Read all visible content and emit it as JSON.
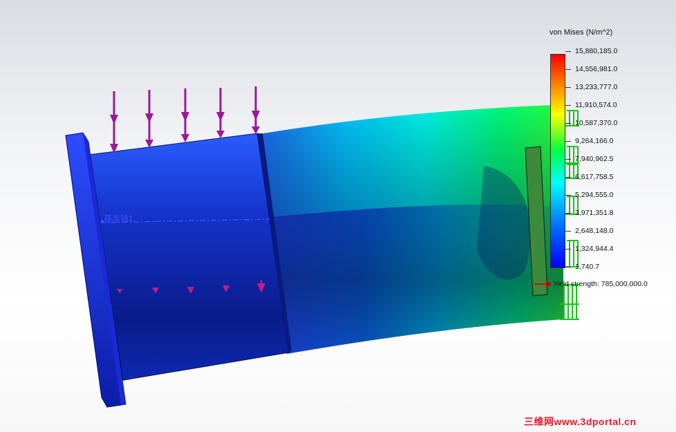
{
  "plot": {
    "legend_title": "von Mises (N/m^2)",
    "ticks": [
      "15,880,185.0",
      "14,556,981.0",
      "13,233,777.0",
      "11,910,574.0",
      "10,587,370.0",
      "9,264,166.0",
      "7,940,962.5",
      "6,617,758.5",
      "5,294,555.0",
      "3,971,351.8",
      "2,648,148.0",
      "1,324,944.4",
      "1,740.7"
    ],
    "yield_label": "Yield strength: 785,000,000.0",
    "colormap": [
      "#ff0000",
      "#ff8000",
      "#ffff00",
      "#00ff40",
      "#00ffff",
      "#0080ff",
      "#0000ff"
    ],
    "axis_label": "基准轴1"
  },
  "watermark": "三维网www.3dportal.cn"
}
